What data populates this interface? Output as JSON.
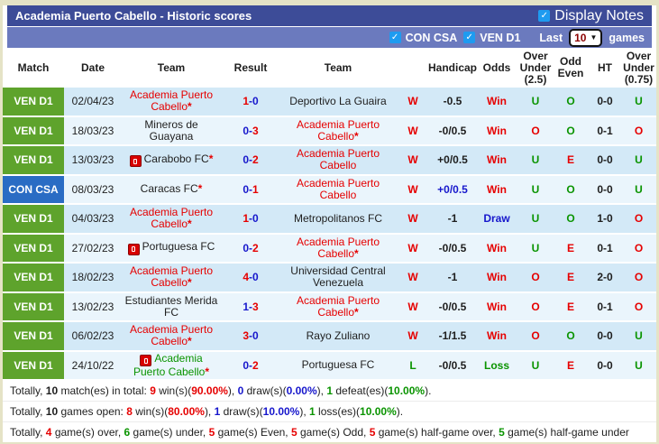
{
  "theme": {
    "red": "#e60000",
    "green": "#0a9400",
    "blue": "#1717cc",
    "black": "#1e1e1e",
    "badge_green": "#5ea32c",
    "badge_blue": "#2a6cc4",
    "bar_dark": "#3d4c98",
    "bar_light": "#6b7abe",
    "checkbox_blue": "#1e9bf0",
    "row_odd": "#d3e9f7",
    "row_even": "#eaf5fc"
  },
  "header": {
    "title": "Academia Puerto Cabello - Historic scores",
    "display_notes_label": "Display Notes",
    "filters": {
      "con_csa_label": "CON CSA",
      "ven_d1_label": "VEN D1",
      "last_label": "Last",
      "games_count": "10",
      "games_label": "games"
    }
  },
  "table": {
    "columns": [
      "Match",
      "Date",
      "Team",
      "Result",
      "Team",
      "",
      "Handicap",
      "Odds",
      "Over\nUnder\n(2.5)",
      "Odd\nEven",
      "HT",
      "Over\nUnder\n(0.75)"
    ],
    "rows": [
      {
        "league": "VEN D1",
        "league_color": "green",
        "date": "02/04/23",
        "home": {
          "name": "Academia Puerto Cabello",
          "c": "red",
          "star": true
        },
        "score": {
          "h": "1",
          "hc": "red",
          "a": "0",
          "ac": "blue"
        },
        "away": {
          "name": "Deportivo La Guaira",
          "c": "black"
        },
        "wl": {
          "t": "W",
          "c": "red"
        },
        "handicap": {
          "t": "-0.5",
          "c": "black"
        },
        "odds": {
          "t": "Win",
          "c": "red"
        },
        "ou25": {
          "t": "U",
          "c": "green"
        },
        "oe": {
          "t": "O",
          "c": "green"
        },
        "ht": "0-0",
        "ou075": {
          "t": "U",
          "c": "green"
        }
      },
      {
        "league": "VEN D1",
        "league_color": "green",
        "date": "18/03/23",
        "home": {
          "name": "Mineros de Guayana",
          "c": "black"
        },
        "score": {
          "h": "0",
          "hc": "blue",
          "a": "3",
          "ac": "red"
        },
        "away": {
          "name": "Academia Puerto Cabello",
          "c": "red",
          "star": true
        },
        "wl": {
          "t": "W",
          "c": "red"
        },
        "handicap": {
          "t": "-0/0.5",
          "c": "black"
        },
        "odds": {
          "t": "Win",
          "c": "red"
        },
        "ou25": {
          "t": "O",
          "c": "red"
        },
        "oe": {
          "t": "O",
          "c": "green"
        },
        "ht": "0-1",
        "ou075": {
          "t": "O",
          "c": "red"
        }
      },
      {
        "league": "VEN D1",
        "league_color": "green",
        "date": "13/03/23",
        "home": {
          "name": "Carabobo FC",
          "c": "black",
          "star": true,
          "icon": true
        },
        "score": {
          "h": "0",
          "hc": "blue",
          "a": "2",
          "ac": "red"
        },
        "away": {
          "name": "Academia Puerto Cabello",
          "c": "red"
        },
        "wl": {
          "t": "W",
          "c": "red"
        },
        "handicap": {
          "t": "+0/0.5",
          "c": "black"
        },
        "odds": {
          "t": "Win",
          "c": "red"
        },
        "ou25": {
          "t": "U",
          "c": "green"
        },
        "oe": {
          "t": "E",
          "c": "red"
        },
        "ht": "0-0",
        "ou075": {
          "t": "U",
          "c": "green"
        }
      },
      {
        "league": "CON CSA",
        "league_color": "blue",
        "date": "08/03/23",
        "home": {
          "name": "Caracas FC",
          "c": "black",
          "star": true
        },
        "score": {
          "h": "0",
          "hc": "blue",
          "a": "1",
          "ac": "red"
        },
        "away": {
          "name": "Academia Puerto Cabello",
          "c": "red"
        },
        "wl": {
          "t": "W",
          "c": "red"
        },
        "handicap": {
          "t": "+0/0.5",
          "c": "blue"
        },
        "odds": {
          "t": "Win",
          "c": "red"
        },
        "ou25": {
          "t": "U",
          "c": "green"
        },
        "oe": {
          "t": "O",
          "c": "green"
        },
        "ht": "0-0",
        "ou075": {
          "t": "U",
          "c": "green"
        }
      },
      {
        "league": "VEN D1",
        "league_color": "green",
        "date": "04/03/23",
        "home": {
          "name": "Academia Puerto Cabello",
          "c": "red",
          "star": true
        },
        "score": {
          "h": "1",
          "hc": "red",
          "a": "0",
          "ac": "blue"
        },
        "away": {
          "name": "Metropolitanos FC",
          "c": "black"
        },
        "wl": {
          "t": "W",
          "c": "red"
        },
        "handicap": {
          "t": "-1",
          "c": "black"
        },
        "odds": {
          "t": "Draw",
          "c": "blue"
        },
        "ou25": {
          "t": "U",
          "c": "green"
        },
        "oe": {
          "t": "O",
          "c": "green"
        },
        "ht": "1-0",
        "ou075": {
          "t": "O",
          "c": "red"
        }
      },
      {
        "league": "VEN D1",
        "league_color": "green",
        "date": "27/02/23",
        "home": {
          "name": "Portuguesa FC",
          "c": "black",
          "icon": true
        },
        "score": {
          "h": "0",
          "hc": "blue",
          "a": "2",
          "ac": "red"
        },
        "away": {
          "name": "Academia Puerto Cabello",
          "c": "red",
          "star": true
        },
        "wl": {
          "t": "W",
          "c": "red"
        },
        "handicap": {
          "t": "-0/0.5",
          "c": "black"
        },
        "odds": {
          "t": "Win",
          "c": "red"
        },
        "ou25": {
          "t": "U",
          "c": "green"
        },
        "oe": {
          "t": "E",
          "c": "red"
        },
        "ht": "0-1",
        "ou075": {
          "t": "O",
          "c": "red"
        }
      },
      {
        "league": "VEN D1",
        "league_color": "green",
        "date": "18/02/23",
        "home": {
          "name": "Academia Puerto Cabello",
          "c": "red",
          "star": true
        },
        "score": {
          "h": "4",
          "hc": "red",
          "a": "0",
          "ac": "blue"
        },
        "away": {
          "name": "Universidad Central Venezuela",
          "c": "black"
        },
        "wl": {
          "t": "W",
          "c": "red"
        },
        "handicap": {
          "t": "-1",
          "c": "black"
        },
        "odds": {
          "t": "Win",
          "c": "red"
        },
        "ou25": {
          "t": "O",
          "c": "red"
        },
        "oe": {
          "t": "E",
          "c": "red"
        },
        "ht": "2-0",
        "ou075": {
          "t": "O",
          "c": "red"
        }
      },
      {
        "league": "VEN D1",
        "league_color": "green",
        "date": "13/02/23",
        "home": {
          "name": "Estudiantes Merida FC",
          "c": "black"
        },
        "score": {
          "h": "1",
          "hc": "blue",
          "a": "3",
          "ac": "red"
        },
        "away": {
          "name": "Academia Puerto Cabello",
          "c": "red",
          "star": true
        },
        "wl": {
          "t": "W",
          "c": "red"
        },
        "handicap": {
          "t": "-0/0.5",
          "c": "black"
        },
        "odds": {
          "t": "Win",
          "c": "red"
        },
        "ou25": {
          "t": "O",
          "c": "red"
        },
        "oe": {
          "t": "E",
          "c": "red"
        },
        "ht": "0-1",
        "ou075": {
          "t": "O",
          "c": "red"
        }
      },
      {
        "league": "VEN D1",
        "league_color": "green",
        "date": "06/02/23",
        "home": {
          "name": "Academia Puerto Cabello",
          "c": "red",
          "star": true
        },
        "score": {
          "h": "3",
          "hc": "red",
          "a": "0",
          "ac": "blue"
        },
        "away": {
          "name": "Rayo Zuliano",
          "c": "black"
        },
        "wl": {
          "t": "W",
          "c": "red"
        },
        "handicap": {
          "t": "-1/1.5",
          "c": "black"
        },
        "odds": {
          "t": "Win",
          "c": "red"
        },
        "ou25": {
          "t": "O",
          "c": "red"
        },
        "oe": {
          "t": "O",
          "c": "green"
        },
        "ht": "0-0",
        "ou075": {
          "t": "U",
          "c": "green"
        }
      },
      {
        "league": "VEN D1",
        "league_color": "green",
        "date": "24/10/22",
        "home": {
          "name": "Academia Puerto Cabello",
          "c": "green",
          "star": true,
          "icon": true
        },
        "score": {
          "h": "0",
          "hc": "blue",
          "a": "2",
          "ac": "red"
        },
        "away": {
          "name": "Portuguesa FC",
          "c": "black"
        },
        "wl": {
          "t": "L",
          "c": "green"
        },
        "handicap": {
          "t": "-0/0.5",
          "c": "black"
        },
        "odds": {
          "t": "Loss",
          "c": "green"
        },
        "ou25": {
          "t": "U",
          "c": "green"
        },
        "oe": {
          "t": "E",
          "c": "red"
        },
        "ht": "0-0",
        "ou075": {
          "t": "U",
          "c": "green"
        }
      }
    ]
  },
  "footer": {
    "lines": [
      [
        {
          "t": "Totally, "
        },
        {
          "t": "10",
          "b": 1
        },
        {
          "t": " match(es) in total: "
        },
        {
          "t": "9",
          "b": 1,
          "c": "red"
        },
        {
          "t": " win(s)("
        },
        {
          "t": "90.00%",
          "b": 1,
          "c": "red"
        },
        {
          "t": "), "
        },
        {
          "t": "0",
          "b": 1,
          "c": "blue"
        },
        {
          "t": " draw(s)("
        },
        {
          "t": "0.00%",
          "b": 1,
          "c": "blue"
        },
        {
          "t": "), "
        },
        {
          "t": "1",
          "b": 1,
          "c": "green"
        },
        {
          "t": " defeat(es)("
        },
        {
          "t": "10.00%",
          "b": 1,
          "c": "green"
        },
        {
          "t": ")."
        }
      ],
      [
        {
          "t": "Totally, "
        },
        {
          "t": "10",
          "b": 1
        },
        {
          "t": " games open: "
        },
        {
          "t": "8",
          "b": 1,
          "c": "red"
        },
        {
          "t": " win(s)("
        },
        {
          "t": "80.00%",
          "b": 1,
          "c": "red"
        },
        {
          "t": "), "
        },
        {
          "t": "1",
          "b": 1,
          "c": "blue"
        },
        {
          "t": " draw(s)("
        },
        {
          "t": "10.00%",
          "b": 1,
          "c": "blue"
        },
        {
          "t": "), "
        },
        {
          "t": "1",
          "b": 1,
          "c": "green"
        },
        {
          "t": " loss(es)("
        },
        {
          "t": "10.00%",
          "b": 1,
          "c": "green"
        },
        {
          "t": ")."
        }
      ],
      [
        {
          "t": "Totally, "
        },
        {
          "t": "4",
          "b": 1,
          "c": "red"
        },
        {
          "t": " game(s) over, "
        },
        {
          "t": "6",
          "b": 1,
          "c": "green"
        },
        {
          "t": " game(s) under, "
        },
        {
          "t": "5",
          "b": 1,
          "c": "red"
        },
        {
          "t": " game(s) Even, "
        },
        {
          "t": "5",
          "b": 1,
          "c": "red"
        },
        {
          "t": " game(s) Odd, "
        },
        {
          "t": "5",
          "b": 1,
          "c": "red"
        },
        {
          "t": " game(s) half-game over, "
        },
        {
          "t": "5",
          "b": 1,
          "c": "green"
        },
        {
          "t": " game(s) half-game under"
        }
      ]
    ]
  }
}
